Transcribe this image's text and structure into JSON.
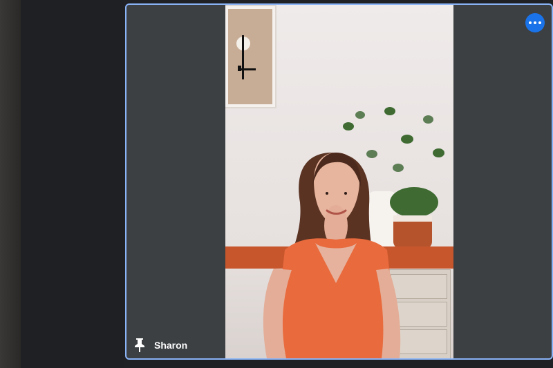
{
  "participant": {
    "name": "Sharon"
  },
  "icons": {
    "pin": "pin-icon",
    "more": "more-options-icon"
  },
  "colors": {
    "active_border": "#8ab4f8",
    "button_blue": "#1a73e8",
    "tile_background": "#3c4043"
  }
}
